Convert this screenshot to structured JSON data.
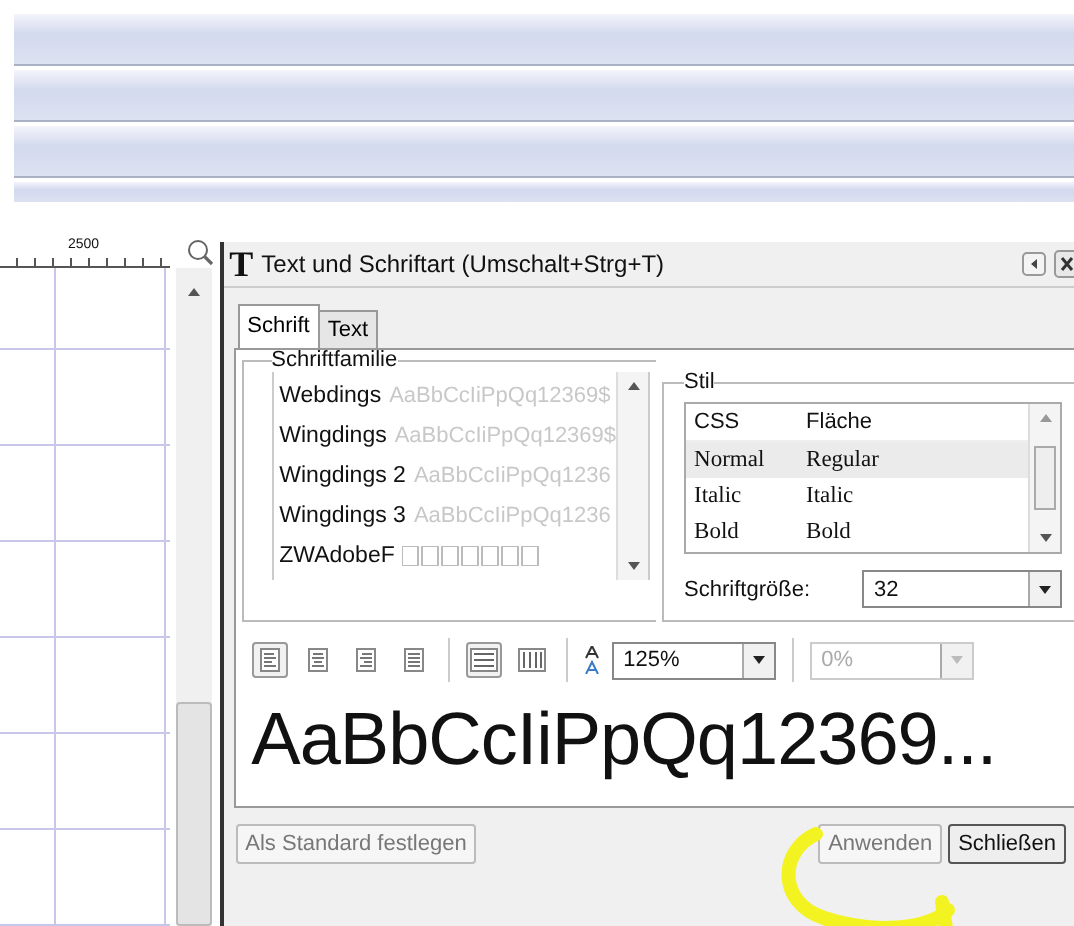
{
  "ruler": {
    "label": "2500"
  },
  "dialog": {
    "title_icon": "T",
    "title": "Text und Schriftart (Umschalt+Strg+T)",
    "tabs": [
      {
        "label": "Schrift",
        "selected": true
      },
      {
        "label": "Text",
        "selected": false
      }
    ],
    "font_family": {
      "legend": "Schriftfamilie",
      "items": [
        {
          "name": "Webdings",
          "sample": "AaBbCcIiPpQq12369$"
        },
        {
          "name": "Wingdings",
          "sample": "AaBbCcIiPpQq12369$"
        },
        {
          "name": "Wingdings 2",
          "sample": "AaBbCcIiPpQq1236"
        },
        {
          "name": "Wingdings 3",
          "sample": "AaBbCcIiPpQq1236"
        },
        {
          "name": "ZWAdobeF"
        }
      ]
    },
    "style": {
      "legend": "Stil",
      "columns": [
        "CSS",
        "Fläche"
      ],
      "rows": [
        {
          "css": "Normal",
          "face": "Regular",
          "selected": true
        },
        {
          "css": "Italic",
          "face": "Italic",
          "selected": false
        },
        {
          "css": "Bold",
          "face": "Bold",
          "selected": false
        }
      ],
      "size_label": "Schriftgröße:",
      "size_value": "32"
    },
    "alignment": [
      {
        "selected": true
      },
      {
        "selected": false
      },
      {
        "selected": false
      },
      {
        "selected": false
      }
    ],
    "orientation": [
      {
        "selected": true
      },
      {
        "selected": false
      }
    ],
    "line_spacing": "125%",
    "letter_spacing": {
      "value": "0%",
      "disabled": true
    },
    "preview": "AaBbCcIiPpQq12369...",
    "buttons": [
      {
        "label": "Als Standard festlegen",
        "kind": "left"
      },
      {
        "label": "Anwenden",
        "kind": "right"
      },
      {
        "label": "Schließen",
        "kind": "right"
      }
    ]
  }
}
